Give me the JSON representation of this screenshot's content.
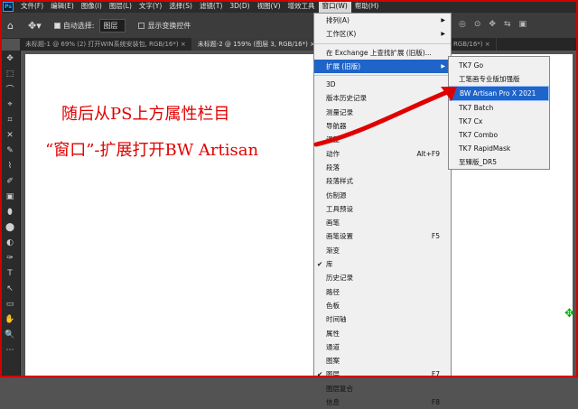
{
  "menubar": {
    "logo": "Ps",
    "items": [
      "文件(F)",
      "编辑(E)",
      "图像(I)",
      "图层(L)",
      "文字(Y)",
      "选择(S)",
      "滤镜(T)",
      "3D(D)",
      "视图(V)",
      "增效工具",
      "窗口(W)",
      "帮助(H)"
    ]
  },
  "options": {
    "auto_select_label": "自动选择:",
    "auto_select_value": "图层",
    "transform_label": "显示变换控件"
  },
  "tabs": [
    "未标题-1 @ 69% (2) 打开WIN系统安装包, RGB/16*) ×",
    "未标题-2 @ 159% (图层 3, RGB/16*) ×",
    "RGB/16*) ×"
  ],
  "annotation": {
    "line1": "随后从PS上方属性栏目",
    "line2": "“窗口”-扩展打开BW Artisan"
  },
  "window_menu": [
    {
      "label": "排列(A)",
      "arrow": true
    },
    {
      "label": "工作区(K)",
      "arrow": true
    },
    {
      "sep": true
    },
    {
      "label": "在 Exchange 上查找扩展 (旧版)..."
    },
    {
      "label": "扩展 (旧版)",
      "arrow": true,
      "highlight": true
    },
    {
      "sep": true
    },
    {
      "label": "3D"
    },
    {
      "label": "版本历史记录"
    },
    {
      "label": "测量记录"
    },
    {
      "label": "导航器"
    },
    {
      "label": "调整"
    },
    {
      "label": "动作",
      "shortcut": "Alt+F9"
    },
    {
      "label": "段落"
    },
    {
      "label": "段落样式"
    },
    {
      "label": "仿制源"
    },
    {
      "label": "工具预设"
    },
    {
      "label": "画笔"
    },
    {
      "label": "画笔设置",
      "shortcut": "F5"
    },
    {
      "label": "渐变"
    },
    {
      "label": "库",
      "checked": true
    },
    {
      "label": "历史记录"
    },
    {
      "label": "路径"
    },
    {
      "label": "色板"
    },
    {
      "label": "时间轴"
    },
    {
      "label": "属性"
    },
    {
      "label": "通道"
    },
    {
      "label": "图案"
    },
    {
      "label": "图层",
      "shortcut": "F7",
      "checked": true
    },
    {
      "label": "图层复合"
    },
    {
      "label": "信息",
      "shortcut": "F8"
    }
  ],
  "ext_submenu": [
    {
      "label": "TK7 Go"
    },
    {
      "label": "工笔画专业版加强版"
    },
    {
      "label": "BW Artisan Pro X 2021",
      "highlight": true
    },
    {
      "label": "TK7 Batch"
    },
    {
      "label": "TK7 Cx"
    },
    {
      "label": "TK7 Combo"
    },
    {
      "label": "TK7 RapidMask"
    },
    {
      "label": "至臻版_DR5"
    }
  ],
  "tools": [
    "✥",
    "⬚",
    "⌒",
    "⌖",
    "⌗",
    "✕",
    "✎",
    "⌇",
    "✐",
    "▣",
    "⬮",
    "⬤",
    "◐",
    "✑",
    "T",
    "↖",
    "▭",
    "✋",
    "🔍",
    "⋯"
  ],
  "colors": {
    "highlight": "#1f64c8",
    "annotation": "#e00000",
    "frame": "#d40000"
  }
}
